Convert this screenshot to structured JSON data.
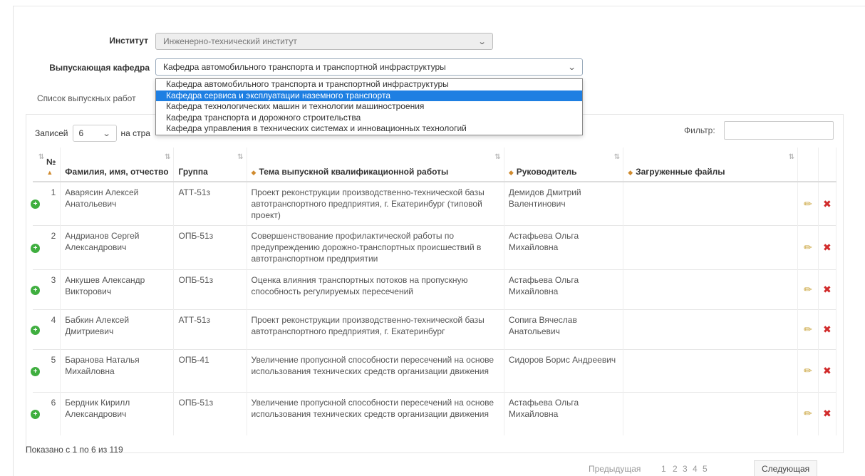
{
  "form": {
    "institute_label": "Институт",
    "institute_value": "Инженерно-технический институт",
    "department_label": "Выпускающая кафедра",
    "department_value": "Кафедра автомобильного транспорта и транспортной инфраструктуры"
  },
  "dropdown": {
    "options": [
      "Кафедра автомобильного транспорта и транспортной инфраструктуры",
      "Кафедра сервиса и эксплуатации наземного транспорта",
      "Кафедра технологических машин и технологии машиностроения",
      "Кафедра транспорта и дорожного строительства",
      "Кафедра управления в технических системах и инновационных технологий"
    ],
    "highlighted_index": 1
  },
  "list_title": "Список выпускных работ",
  "controls": {
    "entries_prefix": "Записей",
    "entries_value": "6",
    "entries_suffix": "на стра",
    "filter_label": "Фильтр:"
  },
  "table": {
    "headers": [
      "№",
      "Фамилия, имя, отчество",
      "Группа",
      "Тема выпускной квалификационной работы",
      "Руководитель",
      "Загруженные файлы"
    ],
    "rows": [
      {
        "n": "1",
        "name": "Аварясин Алексей Анатольевич",
        "group": "АТТ-51з",
        "topic": "Проект реконструкции производственно-технической базы автотранспортного предприятия, г. Екатеринбург (типовой проект)",
        "supervisor": "Демидов Дмитрий Валентинович",
        "files": ""
      },
      {
        "n": "2",
        "name": "Андрианов Сергей Александрович",
        "group": "ОПБ-51з",
        "topic": "Совершенствование профилактической работы по предупреждению дорожно-транспортных происшествий в автотранспортном предприятии",
        "supervisor": "Астафьева Ольга Михайловна",
        "files": ""
      },
      {
        "n": "3",
        "name": "Анкушев Александр Викторович",
        "group": "ОПБ-51з",
        "topic": "Оценка влияния транспортных потоков на пропускную способность регулируемых пересечений",
        "supervisor": "Астафьева Ольга Михайловна",
        "files": ""
      },
      {
        "n": "4",
        "name": "Бабкин Алексей Дмитриевич",
        "group": "АТТ-51з",
        "topic": "Проект реконструкции производственно-технической базы автотранспортного предприятия, г. Екатеринбург",
        "supervisor": "Сопига Вячеслав Анатольевич",
        "files": ""
      },
      {
        "n": "5",
        "name": "Баранова Наталья Михайловна",
        "group": "ОПБ-41",
        "topic": "Увеличение пропускной способности пересечений на основе использования технических средств организации движения",
        "supervisor": "Сидоров Борис Андреевич",
        "files": ""
      },
      {
        "n": "6",
        "name": "Бердник Кирилл Александрович",
        "group": "ОПБ-51з",
        "topic": "Увеличение пропускной способности пересечений на основе использования технических средств организации движения",
        "supervisor": "Астафьева Ольга Михайловна",
        "files": ""
      }
    ]
  },
  "footer": {
    "info": "Показано с 1 по 6 из 119",
    "prev": "Предыдущая",
    "pages": [
      "1",
      "2",
      "3",
      "4",
      "5"
    ],
    "next": "Следующая"
  },
  "icons": {
    "edit": "pencil-icon",
    "delete": "delete-icon",
    "expand": "expand-row-icon",
    "sort": "sort-icon",
    "select_arrow": "chevron-down-icon"
  },
  "colors": {
    "highlight": "#1e7fe2",
    "delete": "#d12a2a",
    "edit": "#c9a33a",
    "expand": "#3fae3f"
  }
}
